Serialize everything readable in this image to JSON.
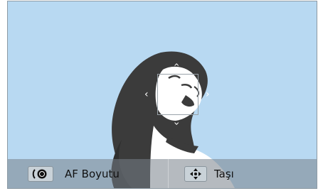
{
  "viewfinder": {
    "background_color": "#b8d9f2"
  },
  "af_point": {
    "nav_icons": [
      "chevron-left-icon",
      "chevron-right-icon",
      "chevron-up-icon",
      "chevron-down-icon"
    ]
  },
  "bottom_bar": {
    "af_size": {
      "icon": "command-dial-icon",
      "label": "AF Boyutu"
    },
    "move": {
      "icon": "directional-pad-icon",
      "label": "Taşı"
    }
  }
}
